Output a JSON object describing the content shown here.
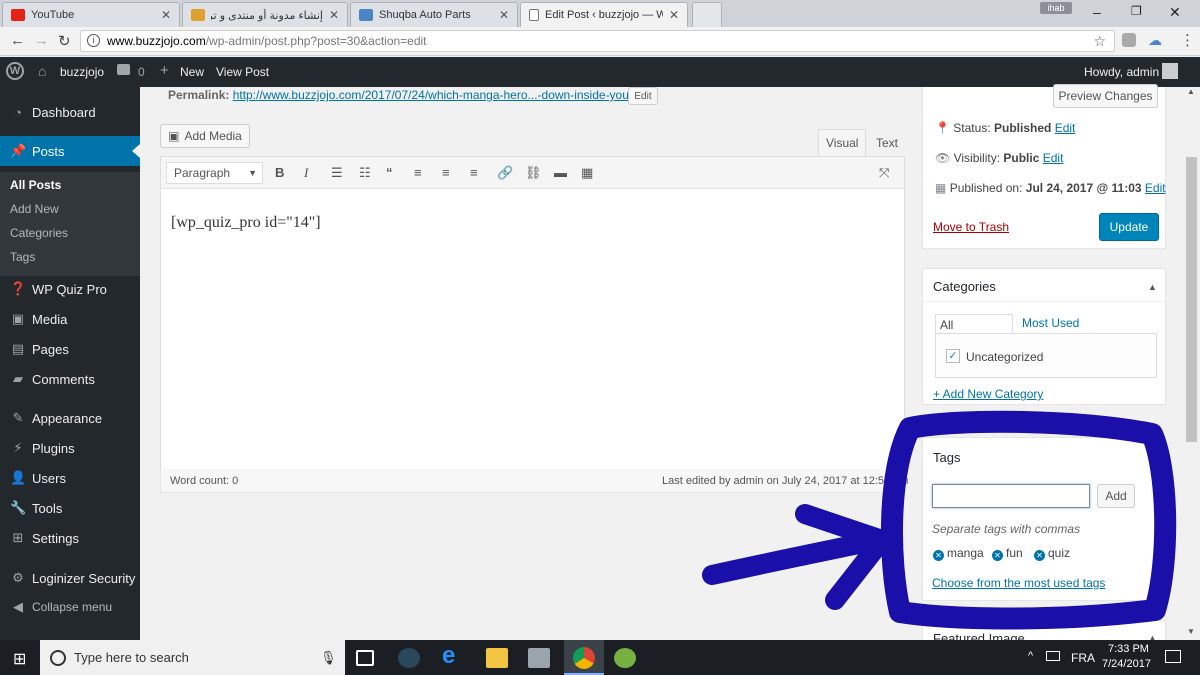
{
  "browser": {
    "tabs": [
      {
        "title": "YouTube",
        "favicon_color": "#e62117"
      },
      {
        "title": "إنشاء مدونة أو منتدى و ترك",
        "favicon_color": "#e0a030"
      },
      {
        "title": "Shuqba Auto Parts",
        "favicon_color": "#4a86c5"
      },
      {
        "title": "Edit Post ‹ buzzjojo — W",
        "favicon_color": "#777777"
      }
    ],
    "user_chip": "ihab",
    "url_host": "www.buzzjojo.com",
    "url_path": "/wp-admin/post.php?post=30&action=edit"
  },
  "adminbar": {
    "site_name": "buzzjojo",
    "comments_count": "0",
    "new_label": "New",
    "view_post_label": "View Post",
    "howdy": "Howdy, admin"
  },
  "sidebar": {
    "dashboard": "Dashboard",
    "posts": "Posts",
    "all_posts": "All Posts",
    "add_new": "Add New",
    "categories": "Categories",
    "tags": "Tags",
    "wp_quiz_pro": "WP Quiz Pro",
    "media": "Media",
    "pages": "Pages",
    "comments": "Comments",
    "appearance": "Appearance",
    "plugins": "Plugins",
    "users": "Users",
    "tools": "Tools",
    "settings": "Settings",
    "loginizer": "Loginizer Security",
    "collapse": "Collapse menu"
  },
  "editor": {
    "permalink_label": "Permalink:",
    "permalink_url": "http://www.buzzjojo.com/2017/07/24/which-manga-hero...-down-inside-you/",
    "edit_permalink": "Edit",
    "add_media": "Add Media",
    "tab_visual": "Visual",
    "tab_text": "Text",
    "format": "Paragraph",
    "content": "[wp_quiz_pro id=\"14\"]",
    "word_count": "Word count: 0",
    "last_edited": "Last edited by admin on July 24, 2017 at 12:50 pm"
  },
  "publish": {
    "preview": "Preview Changes",
    "status_label": "Status:",
    "status_value": "Published",
    "visibility_label": "Visibility:",
    "visibility_value": "Public",
    "published_label": "Published on:",
    "published_value": "Jul 24, 2017 @ 11:03",
    "edit": "Edit",
    "trash": "Move to Trash",
    "update": "Update"
  },
  "categories_box": {
    "title": "Categories",
    "tab_all": "All Categories",
    "tab_most_used": "Most Used",
    "item": "Uncategorized",
    "add_new": "+ Add New Category"
  },
  "tags_box": {
    "title": "Tags",
    "add_button": "Add",
    "hint": "Separate tags with commas",
    "tags": [
      "manga",
      "fun",
      "quiz"
    ],
    "choose": "Choose from the most used tags"
  },
  "featured_image": {
    "title": "Featured Image"
  },
  "taskbar": {
    "search_placeholder": "Type here to search",
    "lang": "FRA",
    "time": "7:33 PM",
    "date": "7/24/2017"
  },
  "colors": {
    "wp_blue": "#0073aa",
    "admin_dark": "#23282d",
    "annotation": "#1a0fa8"
  }
}
